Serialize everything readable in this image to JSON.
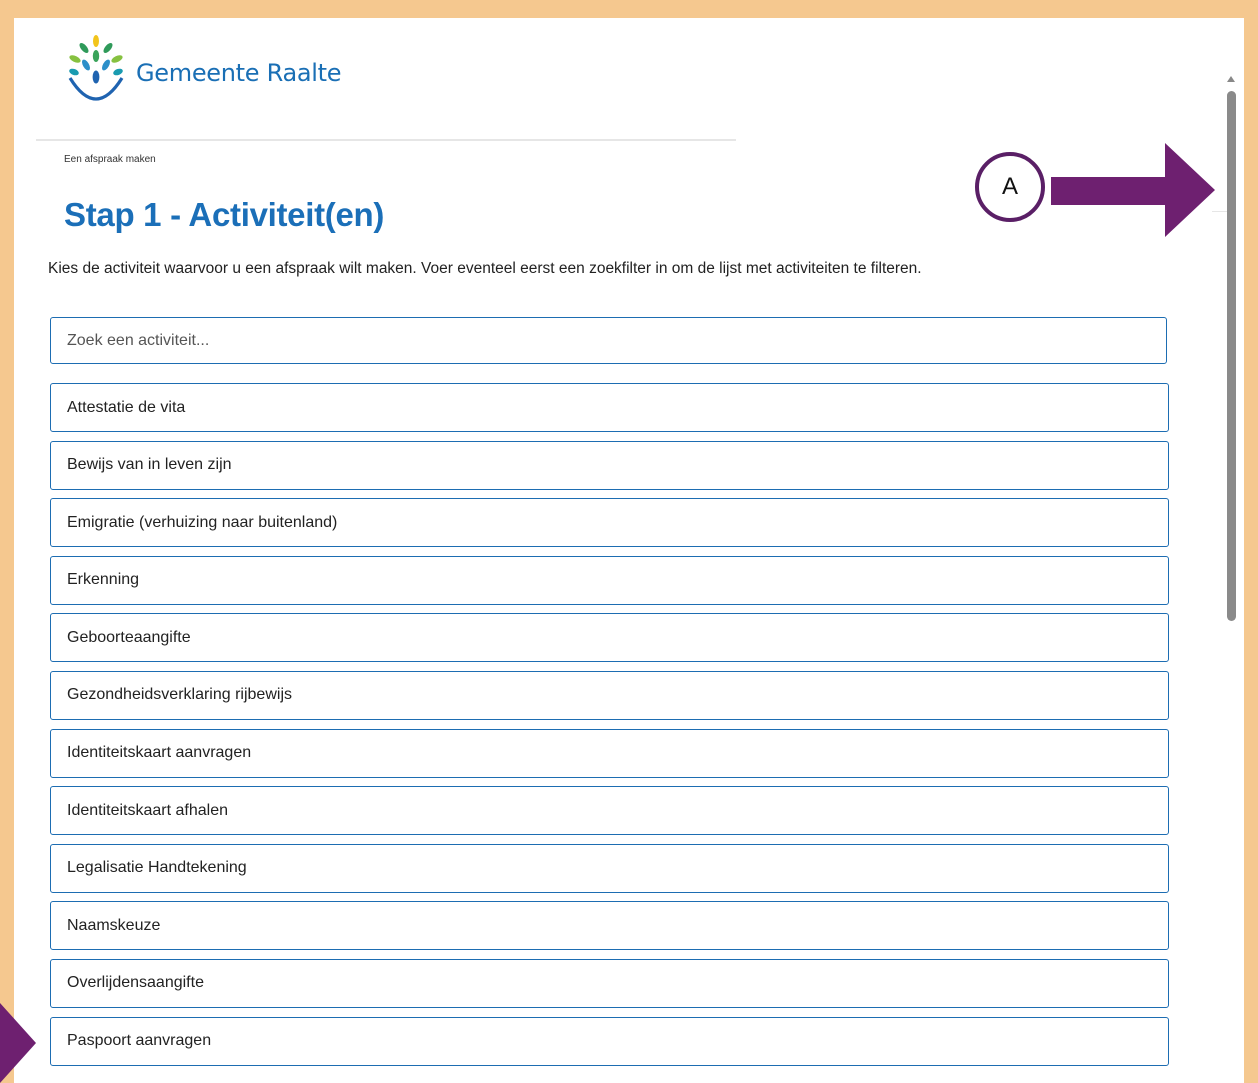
{
  "header": {
    "logo_text": "Gemeente Raalte",
    "breadcrumb": "Een afspraak maken"
  },
  "main": {
    "title": "Stap 1 - Activiteit(en)",
    "intro": "Kies de activiteit waarvoor u een afspraak wilt maken. Voer eventeel eerst een zoekfilter in om de lijst met activiteiten te filteren.",
    "search": {
      "placeholder": "Zoek een activiteit...",
      "value": ""
    },
    "activities": [
      "Attestatie de vita",
      "Bewijs van in leven zijn",
      "Emigratie (verhuizing naar buitenland)",
      "Erkenning",
      "Geboorteaangifte",
      "Gezondheidsverklaring rijbewijs",
      "Identiteitskaart aanvragen",
      "Identiteitskaart afhalen",
      "Legalisatie Handtekening",
      "Naamskeuze",
      "Overlijdensaangifte",
      "Paspoort aanvragen"
    ]
  },
  "annotation": {
    "label": "A",
    "arrow_color": "#6e2070",
    "circle_border_color": "#5a1f66"
  },
  "colors": {
    "frame_background": "#f5c88f",
    "brand_blue": "#1b6fb8",
    "item_border": "#1d6db2"
  }
}
